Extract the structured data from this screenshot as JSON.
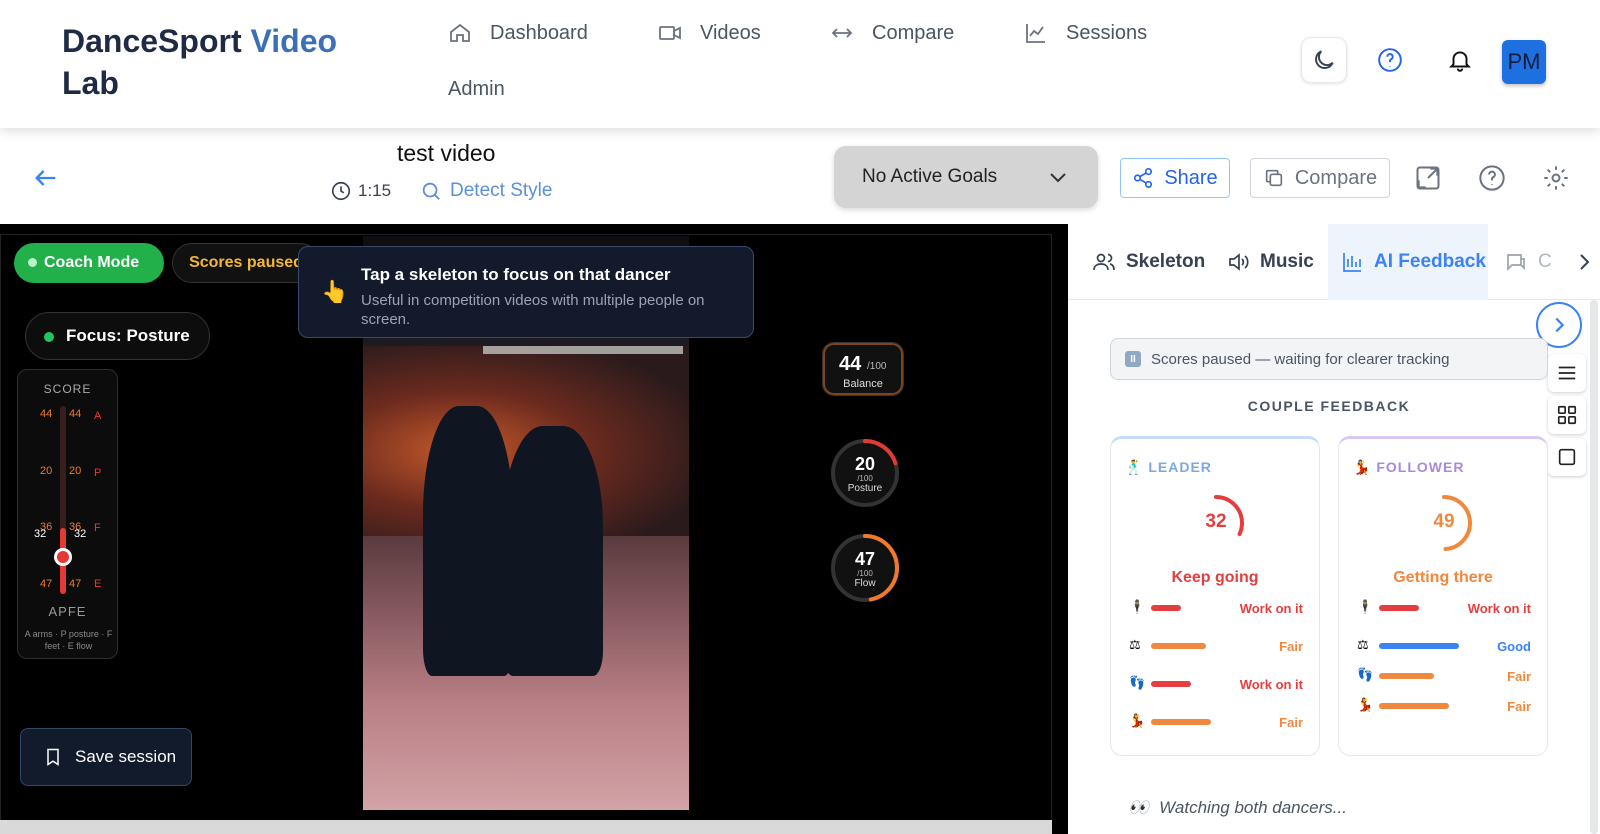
{
  "app": {
    "brand_main": "DanceSport",
    "brand_accent": "Video",
    "brand_tail": "Lab",
    "nav": [
      {
        "label": "Dashboard",
        "icon": "home-icon"
      },
      {
        "label": "Videos",
        "icon": "video-icon"
      },
      {
        "label": "Compare",
        "icon": "arrows-horizontal-icon"
      },
      {
        "label": "Sessions",
        "icon": "chart-line-icon"
      },
      {
        "label": "Admin",
        "icon": ""
      }
    ],
    "avatar_initials": "PM",
    "colors": {
      "brand": "#1f2a44",
      "brand_accent": "#3b6fb6",
      "primary": "#3b82f6",
      "avatar": "#1e6fe0"
    }
  },
  "toolbar": {
    "title": "test video",
    "duration": "1:15",
    "detect_label": "Detect Style",
    "goals_label": "No Active Goals",
    "share_label": "Share",
    "compare_label": "Compare"
  },
  "video": {
    "coach_mode": "Coach Mode",
    "scores_paused": "Scores paused",
    "tooltip_title": "Tap a skeleton to focus on that dancer",
    "tooltip_desc": "Useful in competition videos with multiple people on screen.",
    "focus_label": "Focus: Posture",
    "score_title": "SCORE",
    "score_rows": [
      {
        "left": "44",
        "right": "44",
        "key": "A"
      },
      {
        "left": "20",
        "right": "20",
        "key": "P"
      },
      {
        "left": "36",
        "right": "36",
        "key": "F"
      },
      {
        "left": "47",
        "right": "47",
        "key": "E"
      }
    ],
    "score_current_left": "32",
    "score_current_right": "32",
    "score_current_value": 32,
    "apfe_label": "APFE",
    "apfe_legend": "A arms · P posture · F feet · E flow",
    "balance": {
      "value": "44",
      "max": "/100",
      "label": "Balance"
    },
    "posture": {
      "value": "20",
      "max": "/100",
      "label": "Posture",
      "fraction": 0.2
    },
    "flow": {
      "value": "47",
      "max": "/100",
      "label": "Flow",
      "fraction": 0.47
    },
    "save_label": "Save session"
  },
  "panel": {
    "tabs": [
      {
        "label": "Skeleton",
        "icon": "users-icon"
      },
      {
        "label": "Music",
        "icon": "speaker-icon"
      },
      {
        "label": "AI Feedback",
        "icon": "bar-chart-icon",
        "active": true
      },
      {
        "label": "C",
        "icon": "chat-icon"
      }
    ],
    "notice": "Scores paused — waiting for clearer tracking",
    "notice_icon": "II",
    "couple_title": "COUPLE FEEDBACK",
    "leader": {
      "role": "LEADER",
      "role_icon": "🕺",
      "score": "32",
      "fraction": 0.32,
      "verdict": "Keep going",
      "color": "#e53e3e",
      "role_color": "#7fa9dd",
      "metrics": [
        {
          "icon": "🕴",
          "label": "Work on it",
          "color": "#e53e3e",
          "fraction": 0.3
        },
        {
          "icon": "⚖",
          "label": "Fair",
          "color": "#f0883e",
          "fraction": 0.55
        },
        {
          "icon": "👣",
          "label": "Work on it",
          "color": "#e53e3e",
          "fraction": 0.4
        },
        {
          "icon": "💃",
          "label": "Fair",
          "color": "#f0883e",
          "fraction": 0.6
        }
      ]
    },
    "follower": {
      "role": "FOLLOWER",
      "role_icon": "💃",
      "score": "49",
      "fraction": 0.49,
      "verdict": "Getting there",
      "color": "#f0883e",
      "role_color": "#a78bda",
      "metrics": [
        {
          "icon": "🕴",
          "label": "Work on it",
          "color": "#e53e3e",
          "fraction": 0.4
        },
        {
          "icon": "⚖",
          "label": "Good",
          "color": "#3b82f6",
          "fraction": 0.8
        },
        {
          "icon": "👣",
          "label": "Fair",
          "color": "#f0883e",
          "fraction": 0.55
        },
        {
          "icon": "💃",
          "label": "Fair",
          "color": "#f0883e",
          "fraction": 0.7
        }
      ]
    },
    "watching_icon": "👀",
    "watching": "Watching both dancers..."
  }
}
